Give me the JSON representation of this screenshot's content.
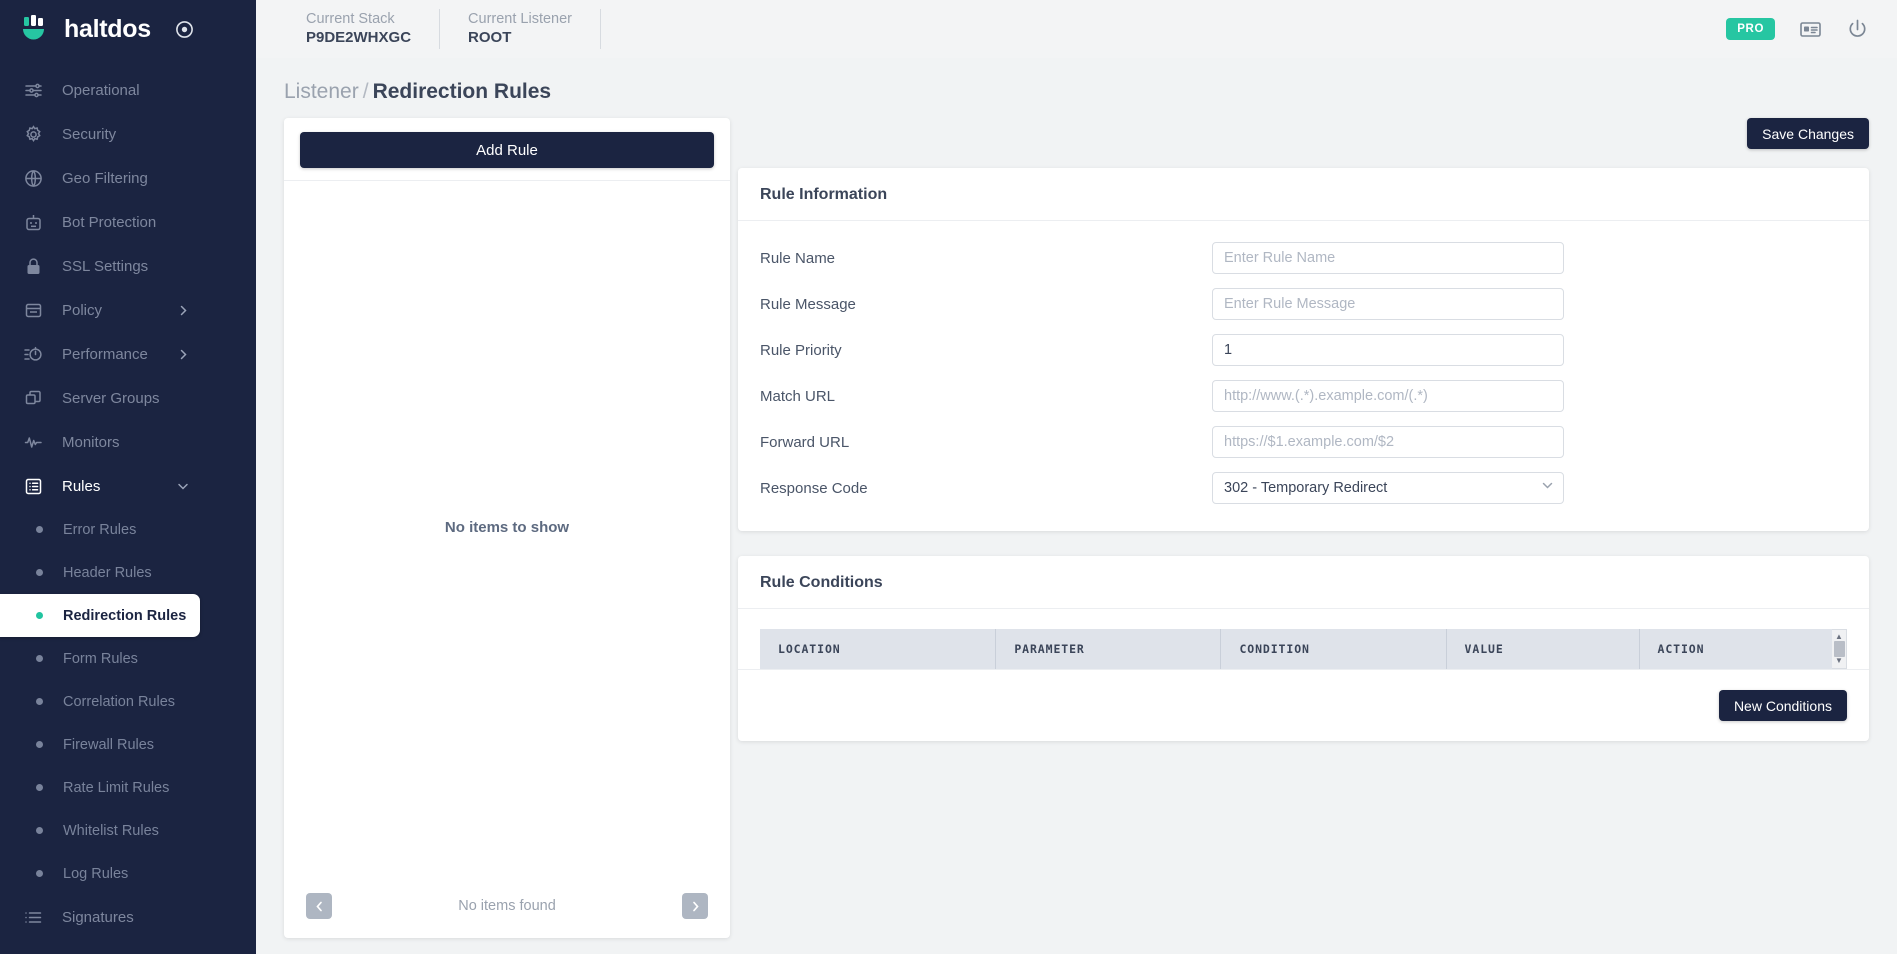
{
  "brand": {
    "name": "haltdos",
    "target_icon": "target-icon"
  },
  "topbar": {
    "stack_label": "Current Stack",
    "stack_value": "P9DE2WHXGC",
    "listener_label": "Current Listener",
    "listener_value": "ROOT",
    "pro_badge": "PRO",
    "license_icon": "id-card-icon",
    "power_icon": "power-icon"
  },
  "sidebar": {
    "items": [
      {
        "label": "Operational",
        "icon": "sliders-icon"
      },
      {
        "label": "Security",
        "icon": "gear-icon"
      },
      {
        "label": "Geo Filtering",
        "icon": "globe-icon"
      },
      {
        "label": "Bot Protection",
        "icon": "robot-icon"
      },
      {
        "label": "SSL Settings",
        "icon": "lock-icon"
      },
      {
        "label": "Policy",
        "icon": "window-icon",
        "chevron": "chevron-right-icon"
      },
      {
        "label": "Performance",
        "icon": "speedometer-icon",
        "chevron": "chevron-right-icon"
      },
      {
        "label": "Server Groups",
        "icon": "copy-icon"
      },
      {
        "label": "Monitors",
        "icon": "pulse-icon"
      },
      {
        "label": "Rules",
        "icon": "list-box-icon",
        "chevron": "chevron-down-icon",
        "expanded": true
      }
    ],
    "rules_children": [
      {
        "label": "Error Rules",
        "active": false
      },
      {
        "label": "Header Rules",
        "active": false
      },
      {
        "label": "Redirection Rules",
        "active": true
      },
      {
        "label": "Form Rules",
        "active": false
      },
      {
        "label": "Correlation Rules",
        "active": false
      },
      {
        "label": "Firewall Rules",
        "active": false
      },
      {
        "label": "Rate Limit Rules",
        "active": false
      },
      {
        "label": "Whitelist Rules",
        "active": false
      },
      {
        "label": "Log Rules",
        "active": false
      }
    ],
    "footer_item": {
      "label": "Signatures",
      "icon": "list-icon"
    }
  },
  "breadcrumb": {
    "parent": "Listener",
    "separator": "/",
    "current": "Redirection Rules"
  },
  "rules_panel": {
    "add_rule_label": "Add Rule",
    "empty_message": "No items to show",
    "pagination_text": "No items found",
    "prev_icon": "chevron-left-icon",
    "next_icon": "chevron-right-icon"
  },
  "actions": {
    "save_changes_label": "Save Changes",
    "new_conditions_label": "New Conditions"
  },
  "rule_information": {
    "title": "Rule Information",
    "fields": [
      {
        "label": "Rule Name",
        "type": "text",
        "value": "",
        "placeholder": "Enter Rule Name"
      },
      {
        "label": "Rule Message",
        "type": "text",
        "value": "",
        "placeholder": "Enter Rule Message"
      },
      {
        "label": "Rule Priority",
        "type": "text",
        "value": "1",
        "placeholder": ""
      },
      {
        "label": "Match URL",
        "type": "text",
        "value": "",
        "placeholder": "http://www.(.*).example.com/(.*)"
      },
      {
        "label": "Forward URL",
        "type": "text",
        "value": "",
        "placeholder": "https://$1.example.com/$2"
      },
      {
        "label": "Response Code",
        "type": "select",
        "value": "302 - Temporary Redirect",
        "placeholder": ""
      }
    ]
  },
  "rule_conditions": {
    "title": "Rule Conditions",
    "columns": [
      "LOCATION",
      "PARAMETER",
      "CONDITION",
      "VALUE",
      "ACTION"
    ],
    "rows": []
  },
  "colors": {
    "sidebar_bg": "#1b2441",
    "accent_teal": "#26c6a2",
    "button_dark": "#1b2441",
    "page_bg": "#f1f3f4"
  }
}
